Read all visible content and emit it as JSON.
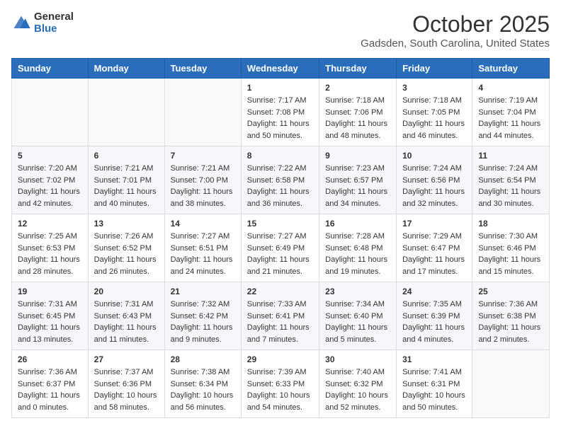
{
  "header": {
    "logo_general": "General",
    "logo_blue": "Blue",
    "month_title": "October 2025",
    "location": "Gadsden, South Carolina, United States"
  },
  "days_of_week": [
    "Sunday",
    "Monday",
    "Tuesday",
    "Wednesday",
    "Thursday",
    "Friday",
    "Saturday"
  ],
  "weeks": [
    [
      {
        "day": "",
        "sunrise": "",
        "sunset": "",
        "daylight": ""
      },
      {
        "day": "",
        "sunrise": "",
        "sunset": "",
        "daylight": ""
      },
      {
        "day": "",
        "sunrise": "",
        "sunset": "",
        "daylight": ""
      },
      {
        "day": "1",
        "sunrise": "Sunrise: 7:17 AM",
        "sunset": "Sunset: 7:08 PM",
        "daylight": "Daylight: 11 hours and 50 minutes."
      },
      {
        "day": "2",
        "sunrise": "Sunrise: 7:18 AM",
        "sunset": "Sunset: 7:06 PM",
        "daylight": "Daylight: 11 hours and 48 minutes."
      },
      {
        "day": "3",
        "sunrise": "Sunrise: 7:18 AM",
        "sunset": "Sunset: 7:05 PM",
        "daylight": "Daylight: 11 hours and 46 minutes."
      },
      {
        "day": "4",
        "sunrise": "Sunrise: 7:19 AM",
        "sunset": "Sunset: 7:04 PM",
        "daylight": "Daylight: 11 hours and 44 minutes."
      }
    ],
    [
      {
        "day": "5",
        "sunrise": "Sunrise: 7:20 AM",
        "sunset": "Sunset: 7:02 PM",
        "daylight": "Daylight: 11 hours and 42 minutes."
      },
      {
        "day": "6",
        "sunrise": "Sunrise: 7:21 AM",
        "sunset": "Sunset: 7:01 PM",
        "daylight": "Daylight: 11 hours and 40 minutes."
      },
      {
        "day": "7",
        "sunrise": "Sunrise: 7:21 AM",
        "sunset": "Sunset: 7:00 PM",
        "daylight": "Daylight: 11 hours and 38 minutes."
      },
      {
        "day": "8",
        "sunrise": "Sunrise: 7:22 AM",
        "sunset": "Sunset: 6:58 PM",
        "daylight": "Daylight: 11 hours and 36 minutes."
      },
      {
        "day": "9",
        "sunrise": "Sunrise: 7:23 AM",
        "sunset": "Sunset: 6:57 PM",
        "daylight": "Daylight: 11 hours and 34 minutes."
      },
      {
        "day": "10",
        "sunrise": "Sunrise: 7:24 AM",
        "sunset": "Sunset: 6:56 PM",
        "daylight": "Daylight: 11 hours and 32 minutes."
      },
      {
        "day": "11",
        "sunrise": "Sunrise: 7:24 AM",
        "sunset": "Sunset: 6:54 PM",
        "daylight": "Daylight: 11 hours and 30 minutes."
      }
    ],
    [
      {
        "day": "12",
        "sunrise": "Sunrise: 7:25 AM",
        "sunset": "Sunset: 6:53 PM",
        "daylight": "Daylight: 11 hours and 28 minutes."
      },
      {
        "day": "13",
        "sunrise": "Sunrise: 7:26 AM",
        "sunset": "Sunset: 6:52 PM",
        "daylight": "Daylight: 11 hours and 26 minutes."
      },
      {
        "day": "14",
        "sunrise": "Sunrise: 7:27 AM",
        "sunset": "Sunset: 6:51 PM",
        "daylight": "Daylight: 11 hours and 24 minutes."
      },
      {
        "day": "15",
        "sunrise": "Sunrise: 7:27 AM",
        "sunset": "Sunset: 6:49 PM",
        "daylight": "Daylight: 11 hours and 21 minutes."
      },
      {
        "day": "16",
        "sunrise": "Sunrise: 7:28 AM",
        "sunset": "Sunset: 6:48 PM",
        "daylight": "Daylight: 11 hours and 19 minutes."
      },
      {
        "day": "17",
        "sunrise": "Sunrise: 7:29 AM",
        "sunset": "Sunset: 6:47 PM",
        "daylight": "Daylight: 11 hours and 17 minutes."
      },
      {
        "day": "18",
        "sunrise": "Sunrise: 7:30 AM",
        "sunset": "Sunset: 6:46 PM",
        "daylight": "Daylight: 11 hours and 15 minutes."
      }
    ],
    [
      {
        "day": "19",
        "sunrise": "Sunrise: 7:31 AM",
        "sunset": "Sunset: 6:45 PM",
        "daylight": "Daylight: 11 hours and 13 minutes."
      },
      {
        "day": "20",
        "sunrise": "Sunrise: 7:31 AM",
        "sunset": "Sunset: 6:43 PM",
        "daylight": "Daylight: 11 hours and 11 minutes."
      },
      {
        "day": "21",
        "sunrise": "Sunrise: 7:32 AM",
        "sunset": "Sunset: 6:42 PM",
        "daylight": "Daylight: 11 hours and 9 minutes."
      },
      {
        "day": "22",
        "sunrise": "Sunrise: 7:33 AM",
        "sunset": "Sunset: 6:41 PM",
        "daylight": "Daylight: 11 hours and 7 minutes."
      },
      {
        "day": "23",
        "sunrise": "Sunrise: 7:34 AM",
        "sunset": "Sunset: 6:40 PM",
        "daylight": "Daylight: 11 hours and 5 minutes."
      },
      {
        "day": "24",
        "sunrise": "Sunrise: 7:35 AM",
        "sunset": "Sunset: 6:39 PM",
        "daylight": "Daylight: 11 hours and 4 minutes."
      },
      {
        "day": "25",
        "sunrise": "Sunrise: 7:36 AM",
        "sunset": "Sunset: 6:38 PM",
        "daylight": "Daylight: 11 hours and 2 minutes."
      }
    ],
    [
      {
        "day": "26",
        "sunrise": "Sunrise: 7:36 AM",
        "sunset": "Sunset: 6:37 PM",
        "daylight": "Daylight: 11 hours and 0 minutes."
      },
      {
        "day": "27",
        "sunrise": "Sunrise: 7:37 AM",
        "sunset": "Sunset: 6:36 PM",
        "daylight": "Daylight: 10 hours and 58 minutes."
      },
      {
        "day": "28",
        "sunrise": "Sunrise: 7:38 AM",
        "sunset": "Sunset: 6:34 PM",
        "daylight": "Daylight: 10 hours and 56 minutes."
      },
      {
        "day": "29",
        "sunrise": "Sunrise: 7:39 AM",
        "sunset": "Sunset: 6:33 PM",
        "daylight": "Daylight: 10 hours and 54 minutes."
      },
      {
        "day": "30",
        "sunrise": "Sunrise: 7:40 AM",
        "sunset": "Sunset: 6:32 PM",
        "daylight": "Daylight: 10 hours and 52 minutes."
      },
      {
        "day": "31",
        "sunrise": "Sunrise: 7:41 AM",
        "sunset": "Sunset: 6:31 PM",
        "daylight": "Daylight: 10 hours and 50 minutes."
      },
      {
        "day": "",
        "sunrise": "",
        "sunset": "",
        "daylight": ""
      }
    ]
  ]
}
